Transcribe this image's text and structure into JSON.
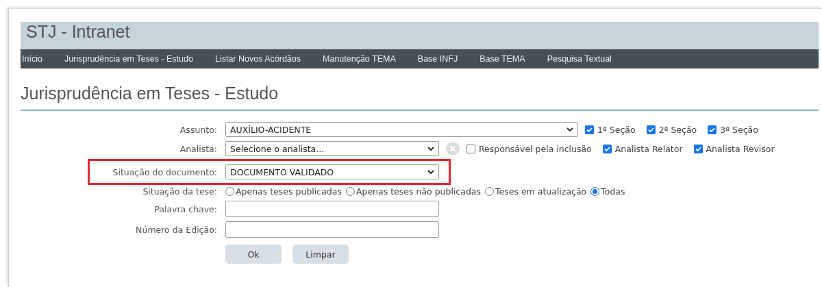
{
  "header": {
    "title": "STJ - Intranet"
  },
  "nav": [
    {
      "label": "Início"
    },
    {
      "label": "Jurisprudência em Teses - Estudo"
    },
    {
      "label": "Listar Novos Acórdãos"
    },
    {
      "label": "Manutenção TEMA"
    },
    {
      "label": "Base INFJ"
    },
    {
      "label": "Base TEMA"
    },
    {
      "label": "Pesquisa Textual"
    }
  ],
  "page_title": "Jurisprudência em Teses - Estudo",
  "form": {
    "assunto": {
      "label": "Assunto:",
      "value": "AUXÍLIO-ACIDENTE",
      "checks": [
        {
          "label": "1ª Seção",
          "checked": true
        },
        {
          "label": "2ª Seção",
          "checked": true
        },
        {
          "label": "3ª Seção",
          "checked": true
        }
      ]
    },
    "analista": {
      "label": "Analista:",
      "value": "Selecione o analista...",
      "checks": [
        {
          "label": "Responsável pela inclusão",
          "checked": false
        },
        {
          "label": "Analista Relator",
          "checked": true
        },
        {
          "label": "Analista Revisor",
          "checked": true
        }
      ]
    },
    "situacao_documento": {
      "label": "Situação do documento:",
      "value": "DOCUMENTO VALIDADO",
      "highlighted": true
    },
    "situacao_tese": {
      "label": "Situação da tese:",
      "options": [
        {
          "label": "Apenas teses publicadas",
          "selected": false
        },
        {
          "label": "Apenas teses não publicadas",
          "selected": false
        },
        {
          "label": "Teses em atualização",
          "selected": false
        },
        {
          "label": "Todas",
          "selected": true
        }
      ]
    },
    "palavra_chave": {
      "label": "Palavra chave:"
    },
    "numero_edicao": {
      "label": "Número da Edição:"
    },
    "buttons": [
      {
        "label": "Ok"
      },
      {
        "label": "Limpar"
      }
    ]
  }
}
